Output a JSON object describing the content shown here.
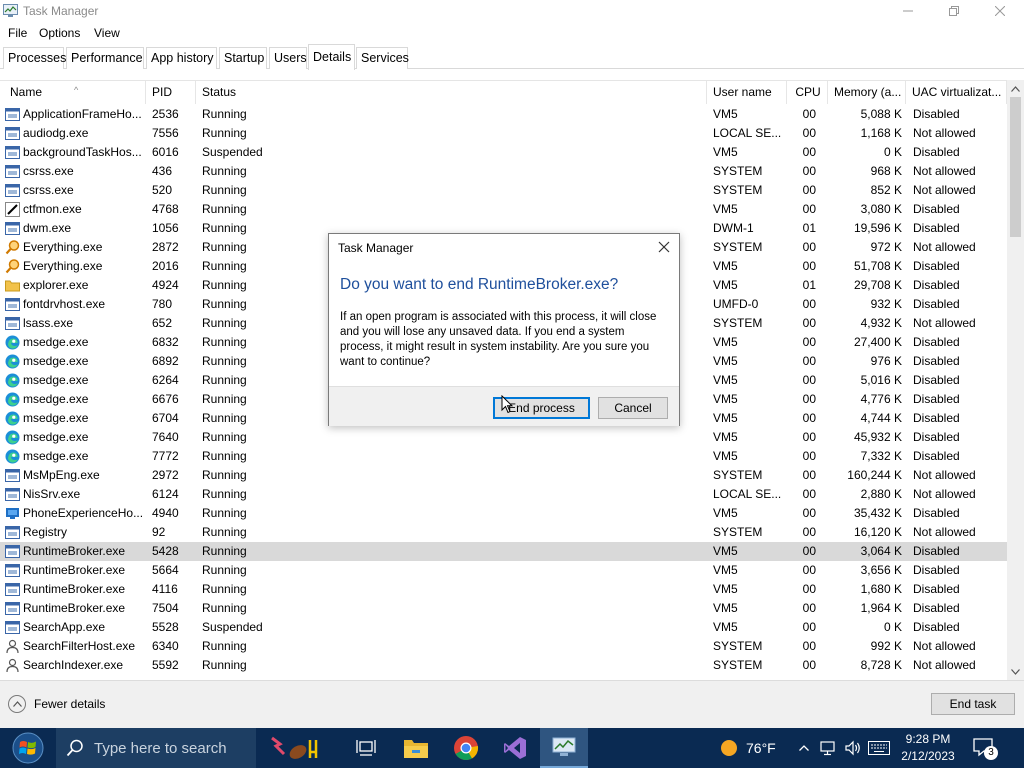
{
  "window": {
    "title": "Task Manager"
  },
  "menu": [
    "File",
    "Options",
    "View"
  ],
  "tabs": [
    "Processes",
    "Performance",
    "App history",
    "Startup",
    "Users",
    "Details",
    "Services"
  ],
  "active_tab": "Details",
  "columns": [
    "Name",
    "PID",
    "Status",
    "User name",
    "CPU",
    "Memory (a...",
    "UAC virtualizat..."
  ],
  "rows": [
    {
      "name": "ApplicationFrameHo...",
      "pid": "2536",
      "status": "Running",
      "user": "VM5",
      "cpu": "00",
      "mem": "5,088 K",
      "uac": "Disabled",
      "icon": "app-window-icon"
    },
    {
      "name": "audiodg.exe",
      "pid": "7556",
      "status": "Running",
      "user": "LOCAL SE...",
      "cpu": "00",
      "mem": "1,168 K",
      "uac": "Not allowed",
      "icon": "app-window-icon"
    },
    {
      "name": "backgroundTaskHos...",
      "pid": "6016",
      "status": "Suspended",
      "user": "VM5",
      "cpu": "00",
      "mem": "0 K",
      "uac": "Disabled",
      "icon": "app-window-icon"
    },
    {
      "name": "csrss.exe",
      "pid": "436",
      "status": "Running",
      "user": "SYSTEM",
      "cpu": "00",
      "mem": "968 K",
      "uac": "Not allowed",
      "icon": "app-window-icon"
    },
    {
      "name": "csrss.exe",
      "pid": "520",
      "status": "Running",
      "user": "SYSTEM",
      "cpu": "00",
      "mem": "852 K",
      "uac": "Not allowed",
      "icon": "app-window-icon"
    },
    {
      "name": "ctfmon.exe",
      "pid": "4768",
      "status": "Running",
      "user": "VM5",
      "cpu": "00",
      "mem": "3,080 K",
      "uac": "Disabled",
      "icon": "pen-icon"
    },
    {
      "name": "dwm.exe",
      "pid": "1056",
      "status": "Running",
      "user": "DWM-1",
      "cpu": "01",
      "mem": "19,596 K",
      "uac": "Disabled",
      "icon": "app-window-icon"
    },
    {
      "name": "Everything.exe",
      "pid": "2872",
      "status": "Running",
      "user": "SYSTEM",
      "cpu": "00",
      "mem": "972 K",
      "uac": "Not allowed",
      "icon": "magnifier-icon"
    },
    {
      "name": "Everything.exe",
      "pid": "2016",
      "status": "Running",
      "user": "VM5",
      "cpu": "00",
      "mem": "51,708 K",
      "uac": "Disabled",
      "icon": "magnifier-icon"
    },
    {
      "name": "explorer.exe",
      "pid": "4924",
      "status": "Running",
      "user": "VM5",
      "cpu": "01",
      "mem": "29,708 K",
      "uac": "Disabled",
      "icon": "folder-icon"
    },
    {
      "name": "fontdrvhost.exe",
      "pid": "780",
      "status": "Running",
      "user": "UMFD-0",
      "cpu": "00",
      "mem": "932 K",
      "uac": "Disabled",
      "icon": "app-window-icon"
    },
    {
      "name": "lsass.exe",
      "pid": "652",
      "status": "Running",
      "user": "SYSTEM",
      "cpu": "00",
      "mem": "4,932 K",
      "uac": "Not allowed",
      "icon": "app-window-icon"
    },
    {
      "name": "msedge.exe",
      "pid": "6832",
      "status": "Running",
      "user": "VM5",
      "cpu": "00",
      "mem": "27,400 K",
      "uac": "Disabled",
      "icon": "edge-icon"
    },
    {
      "name": "msedge.exe",
      "pid": "6892",
      "status": "Running",
      "user": "VM5",
      "cpu": "00",
      "mem": "976 K",
      "uac": "Disabled",
      "icon": "edge-icon"
    },
    {
      "name": "msedge.exe",
      "pid": "6264",
      "status": "Running",
      "user": "VM5",
      "cpu": "00",
      "mem": "5,016 K",
      "uac": "Disabled",
      "icon": "edge-icon"
    },
    {
      "name": "msedge.exe",
      "pid": "6676",
      "status": "Running",
      "user": "VM5",
      "cpu": "00",
      "mem": "4,776 K",
      "uac": "Disabled",
      "icon": "edge-icon"
    },
    {
      "name": "msedge.exe",
      "pid": "6704",
      "status": "Running",
      "user": "VM5",
      "cpu": "00",
      "mem": "4,744 K",
      "uac": "Disabled",
      "icon": "edge-icon"
    },
    {
      "name": "msedge.exe",
      "pid": "7640",
      "status": "Running",
      "user": "VM5",
      "cpu": "00",
      "mem": "45,932 K",
      "uac": "Disabled",
      "icon": "edge-icon"
    },
    {
      "name": "msedge.exe",
      "pid": "7772",
      "status": "Running",
      "user": "VM5",
      "cpu": "00",
      "mem": "7,332 K",
      "uac": "Disabled",
      "icon": "edge-icon"
    },
    {
      "name": "MsMpEng.exe",
      "pid": "2972",
      "status": "Running",
      "user": "SYSTEM",
      "cpu": "00",
      "mem": "160,244 K",
      "uac": "Not allowed",
      "icon": "app-window-icon"
    },
    {
      "name": "NisSrv.exe",
      "pid": "6124",
      "status": "Running",
      "user": "LOCAL SE...",
      "cpu": "00",
      "mem": "2,880 K",
      "uac": "Not allowed",
      "icon": "app-window-icon"
    },
    {
      "name": "PhoneExperienceHo...",
      "pid": "4940",
      "status": "Running",
      "user": "VM5",
      "cpu": "00",
      "mem": "35,432 K",
      "uac": "Disabled",
      "icon": "phone-icon"
    },
    {
      "name": "Registry",
      "pid": "92",
      "status": "Running",
      "user": "SYSTEM",
      "cpu": "00",
      "mem": "16,120 K",
      "uac": "Not allowed",
      "icon": "app-window-icon"
    },
    {
      "name": "RuntimeBroker.exe",
      "pid": "5428",
      "status": "Running",
      "user": "VM5",
      "cpu": "00",
      "mem": "3,064 K",
      "uac": "Disabled",
      "icon": "app-window-icon",
      "selected": true
    },
    {
      "name": "RuntimeBroker.exe",
      "pid": "5664",
      "status": "Running",
      "user": "VM5",
      "cpu": "00",
      "mem": "3,656 K",
      "uac": "Disabled",
      "icon": "app-window-icon"
    },
    {
      "name": "RuntimeBroker.exe",
      "pid": "4116",
      "status": "Running",
      "user": "VM5",
      "cpu": "00",
      "mem": "1,680 K",
      "uac": "Disabled",
      "icon": "app-window-icon"
    },
    {
      "name": "RuntimeBroker.exe",
      "pid": "7504",
      "status": "Running",
      "user": "VM5",
      "cpu": "00",
      "mem": "1,964 K",
      "uac": "Disabled",
      "icon": "app-window-icon"
    },
    {
      "name": "SearchApp.exe",
      "pid": "5528",
      "status": "Suspended",
      "user": "VM5",
      "cpu": "00",
      "mem": "0 K",
      "uac": "Disabled",
      "icon": "app-window-icon"
    },
    {
      "name": "SearchFilterHost.exe",
      "pid": "6340",
      "status": "Running",
      "user": "SYSTEM",
      "cpu": "00",
      "mem": "992 K",
      "uac": "Not allowed",
      "icon": "user-icon"
    },
    {
      "name": "SearchIndexer.exe",
      "pid": "5592",
      "status": "Running",
      "user": "SYSTEM",
      "cpu": "00",
      "mem": "8,728 K",
      "uac": "Not allowed",
      "icon": "user-icon"
    }
  ],
  "bottom": {
    "fewer_details": "Fewer details",
    "end_task": "End task"
  },
  "dialog": {
    "title": "Task Manager",
    "heading": "Do you want to end RuntimeBroker.exe?",
    "body": "If an open program is associated with this process, it will close and you will lose any unsaved data. If you end a system process, it might result in system instability. Are you sure you want to continue?",
    "primary": "End process",
    "cancel": "Cancel"
  },
  "taskbar": {
    "search_placeholder": "Type here to search",
    "weather": "76°F",
    "time": "9:28 PM",
    "date": "2/12/2023",
    "notification_count": "3"
  },
  "colors": {
    "accent": "#0078d7",
    "heading": "#1e4f9c",
    "taskbar": "#0a2a52",
    "selected_row": "#d9d9d9"
  }
}
